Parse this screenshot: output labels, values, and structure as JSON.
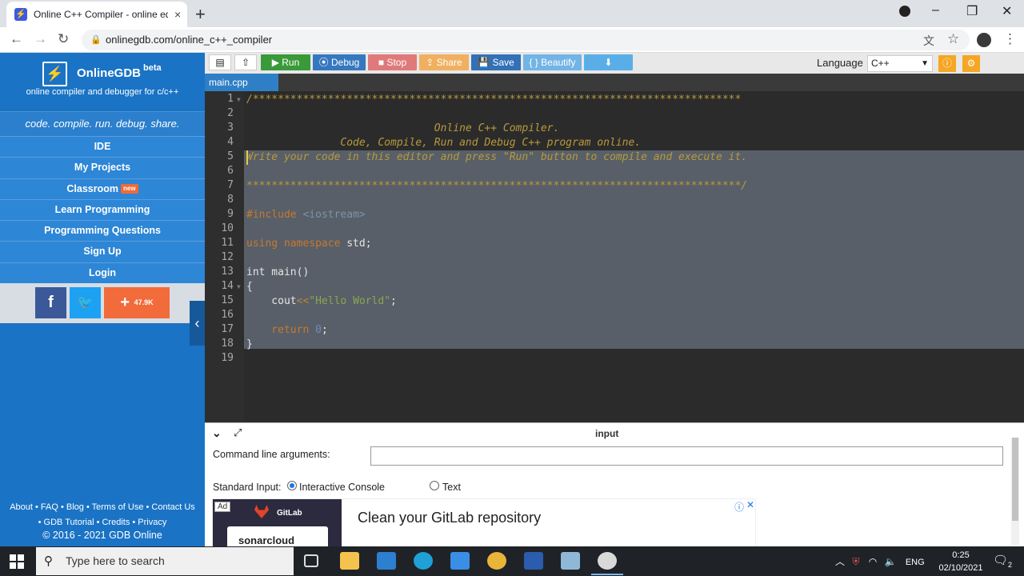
{
  "browser": {
    "tab_title": "Online C++ Compiler - online ed",
    "tab_close": "×",
    "new_tab": "+",
    "url": "onlinegdb.com/online_c++_compiler",
    "win_minimize": "–",
    "win_maximize": "❐",
    "win_close": "✕"
  },
  "sidebar": {
    "logo_name": "OnlineGDB",
    "logo_beta": "beta",
    "logo_sub": "online compiler and debugger for c/c++",
    "tagline": "code. compile. run. debug. share.",
    "items": [
      {
        "label": "IDE"
      },
      {
        "label": "My Projects"
      },
      {
        "label": "Classroom",
        "badge": "new"
      },
      {
        "label": "Learn Programming"
      },
      {
        "label": "Programming Questions"
      },
      {
        "label": "Sign Up"
      },
      {
        "label": "Login"
      }
    ],
    "social": {
      "facebook": "f",
      "twitter": "🐦",
      "share_plus": "+",
      "share_count": "47.9K"
    },
    "footer_line1": "About • FAQ • Blog • Terms of Use • Contact Us",
    "footer_line2": "• GDB Tutorial • Credits • Privacy",
    "copyright": "© 2016 - 2021 GDB Online",
    "collapse_icon": "‹"
  },
  "toolbar": {
    "run": "▶ Run",
    "debug": "⦿ Debug",
    "stop": "■ Stop",
    "share": "⇪ Share",
    "save": "💾 Save",
    "beautify": "{ } Beautify",
    "download": "⬇",
    "language_label": "Language",
    "language_value": "C++",
    "colors": {
      "run": "#3a9a3a",
      "debug": "#3678c0",
      "stop": "#e07a7a",
      "share": "#f0b060",
      "save": "#3270b8",
      "beautify": "#72b4e6",
      "download": "#5aaee8"
    }
  },
  "editor": {
    "file_tab": "main.cpp",
    "line_numbers": [
      "1",
      "2",
      "3",
      "4",
      "5",
      "6",
      "7",
      "8",
      "9",
      "10",
      "11",
      "12",
      "13",
      "14",
      "15",
      "16",
      "17",
      "18",
      "19"
    ],
    "lines": {
      "l1": "/******************************************************************************",
      "l3": "                              Online C++ Compiler.",
      "l4": "               Code, Compile, Run and Debug C++ program online.",
      "l5": "Write your code in this editor and press \"Run\" button to compile and execute it.",
      "l7": "*******************************************************************************/",
      "l9_kw": "#include",
      "l9_inc": " <iostream>",
      "l11_kw": "using namespace",
      "l11_id": " std;",
      "l13": "int main()",
      "l14": "{",
      "l15_a": "    cout",
      "l15_op": "<<",
      "l15_str": "\"Hello World\"",
      "l15_b": ";",
      "l17_kw": "    return",
      "l17_num": " 0",
      "l17_b": ";",
      "l18": "}"
    }
  },
  "input_panel": {
    "title": "input",
    "collapse_icon": "⌄",
    "expand_icon": "⤢",
    "cmd_label": "Command line arguments:",
    "cmd_value": "",
    "stdin_label": "Standard Input:",
    "opt_console": "Interactive Console",
    "opt_text": "Text",
    "selected": "Interactive Console"
  },
  "ad": {
    "badge": "Ad",
    "brand": "GitLab",
    "sonar": "sonarcloud",
    "title": "Clean your GitLab repository",
    "info": "ⓘ",
    "close": "✕"
  },
  "taskbar": {
    "search_placeholder": "Type here to search",
    "lang": "ENG",
    "time": "0:25",
    "date": "02/10/2021",
    "notifications": "2"
  }
}
